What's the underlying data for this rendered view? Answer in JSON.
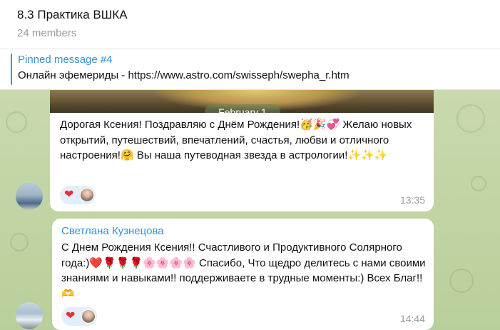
{
  "header": {
    "title": "8.3 Практика ВШКА",
    "members": "24 members"
  },
  "pinned": {
    "title": "Pinned message #4",
    "text": "Онлайн эфемериды - https://www.astro.com/swisseph/swepha_r.htm"
  },
  "date_separator": "February 1",
  "messages": [
    {
      "sender": "",
      "text": "Дорогая Ксения! Поздравляю с Днём Рождения!🥳🎉💞 Желаю новых открытий, путешествий, впечатлений, счастья, любви и отличного настроения!🤗 Вы наша путеводная звезда в астрологии!✨✨✨",
      "time": "13:35",
      "reaction": "❤"
    },
    {
      "sender": "Светлана Кузнецова",
      "text": "С Днем Рождения Ксения!! Счастливого и Продуктивного Солярного года:)❤️🌹🌹🌹🌸🌸🌸🌸 Спасибо, Что щедро делитесь с нами своими знаниями и навыками!! поддерживаете в трудные моменты:) Всех Благ!!🫶",
      "time": "14:44",
      "reaction": "❤"
    }
  ],
  "colors": {
    "accent": "#3a8fd6",
    "chat_background": "#c9d9ae",
    "bubble": "#ffffff",
    "reaction_bg": "#e3eefa",
    "heart": "#e5303a"
  }
}
